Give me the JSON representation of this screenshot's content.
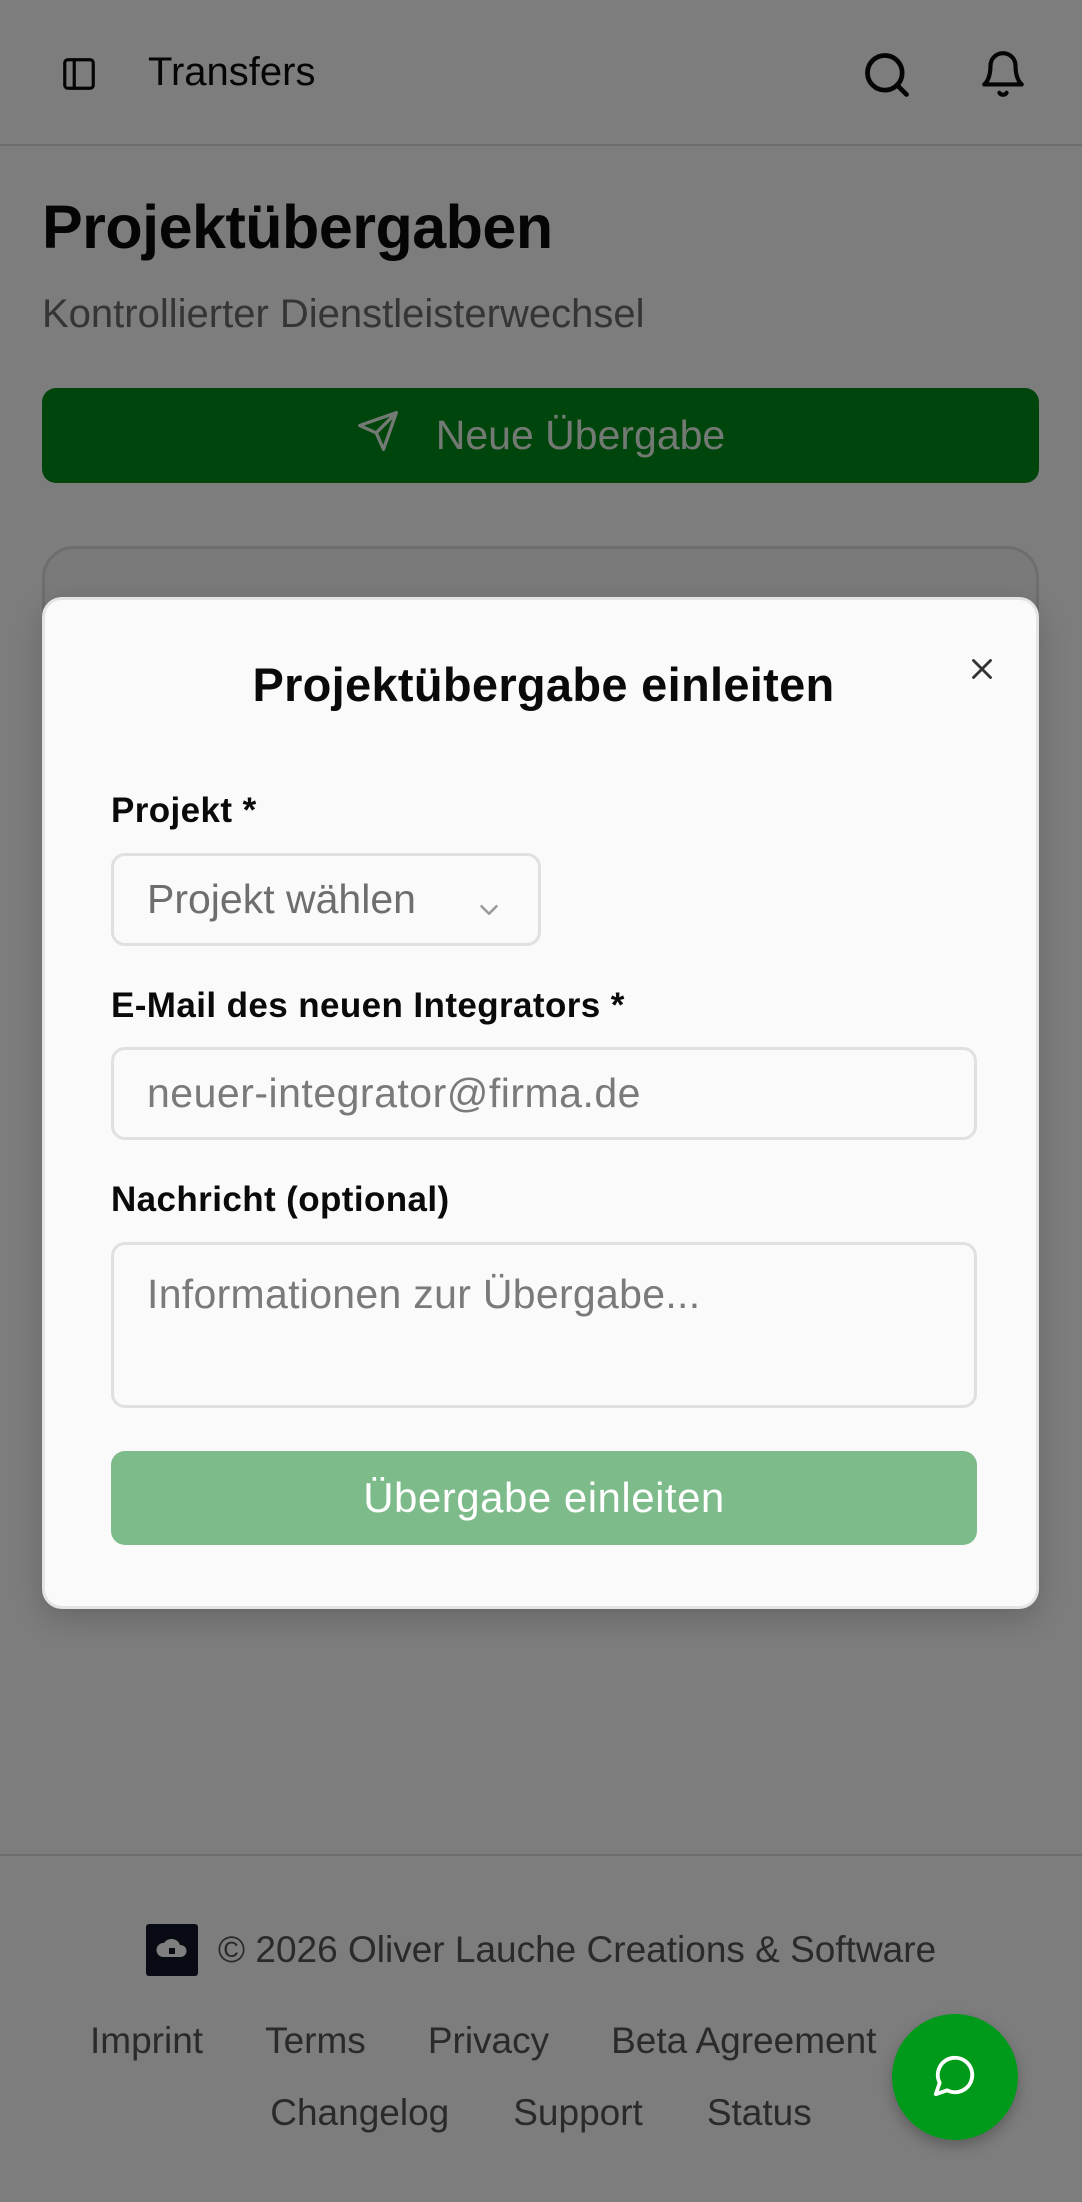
{
  "header": {
    "title": "Transfers",
    "icons": {
      "sidebar": "sidebar-toggle-icon",
      "search": "search-icon",
      "notifications": "bell-icon"
    }
  },
  "page": {
    "title": "Projektübergaben",
    "subtitle": "Kontrollierter Dienstleisterwechsel",
    "new_button_label": "Neue Übergabe"
  },
  "dialog": {
    "title": "Projektübergabe einleiten",
    "project_label": "Projekt *",
    "project_select_value": "Projekt wählen",
    "email_label": "E-Mail des neuen Integrators *",
    "email_placeholder": "neuer-integrator@firma.de",
    "message_label": "Nachricht (optional)",
    "message_placeholder": "Informationen zur Übergabe...",
    "submit_label": "Übergabe einleiten"
  },
  "footer": {
    "copyright": "© 2026 Oliver Lauche Creations & Software",
    "links_row1": [
      "Imprint",
      "Terms",
      "Privacy",
      "Beta Agreement"
    ],
    "links_row2": [
      "Changelog",
      "Support",
      "Status"
    ]
  },
  "colors": {
    "primary": "#008a17",
    "primary_disabled": "#7dbc8a",
    "overlay": "rgba(0,0,0,0.5)",
    "chat_fab": "#009a1a"
  }
}
